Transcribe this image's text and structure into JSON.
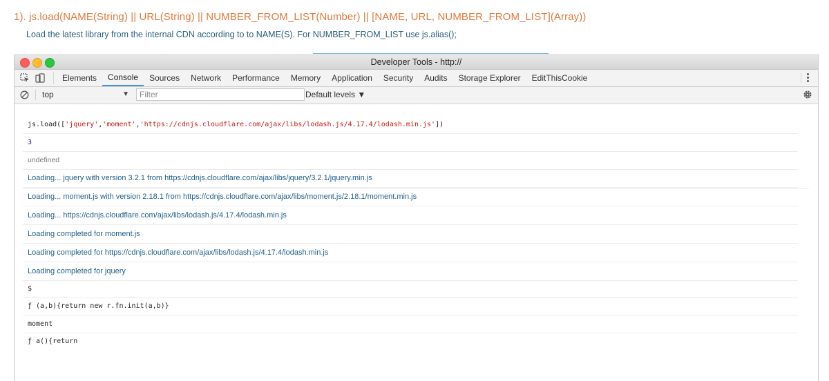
{
  "doc": {
    "heading": "1). js.load(NAME(String) || URL(String) || NUMBER_FROM_LIST(Number) || [NAME, URL, NUMBER_FROM_LIST](Array))",
    "description": "Load the latest library from the internal CDN according to to NAME(S). For NUMBER_FROM_LIST use js.alias();"
  },
  "window": {
    "title": "Developer Tools - http://"
  },
  "tabs": [
    {
      "label": "Elements"
    },
    {
      "label": "Console"
    },
    {
      "label": "Sources"
    },
    {
      "label": "Network"
    },
    {
      "label": "Performance"
    },
    {
      "label": "Memory"
    },
    {
      "label": "Application"
    },
    {
      "label": "Security"
    },
    {
      "label": "Audits"
    },
    {
      "label": "Storage Explorer"
    },
    {
      "label": "EditThisCookie"
    }
  ],
  "filterbar": {
    "context": "top",
    "filter_placeholder": "Filter",
    "levels": "Default levels ▼"
  },
  "console": {
    "command": {
      "prefix": "js.load([",
      "arg1": "'jquery'",
      "comma1": ",",
      "arg2": "'moment'",
      "comma2": ",",
      "arg3": "'https://cdnjs.cloudflare.com/ajax/libs/lodash.js/4.17.4/lodash.min.js'",
      "suffix": "])"
    },
    "result_number": "3",
    "result_undefined": "undefined",
    "log_lines": [
      "Loading... jquery with version 3.2.1 from https://cdnjs.cloudflare.com/ajax/libs/jquery/3.2.1/jquery.min.js",
      "Loading... moment.js with version 2.18.1 from https://cdnjs.cloudflare.com/ajax/libs/moment.js/2.18.1/moment.min.js",
      "Loading... https://cdnjs.cloudflare.com/ajax/libs/lodash.js/4.17.4/lodash.min.js",
      "Loading completed for moment.js",
      "Loading completed for https://cdnjs.cloudflare.com/ajax/libs/lodash.js/4.17.4/lodash.min.js",
      "Loading completed for jquery"
    ],
    "input_dollar": "$",
    "output_dollar": "ƒ (a,b){return new r.fn.init(a,b)}",
    "input_moment": "moment",
    "output_moment": "ƒ a(){return"
  }
}
